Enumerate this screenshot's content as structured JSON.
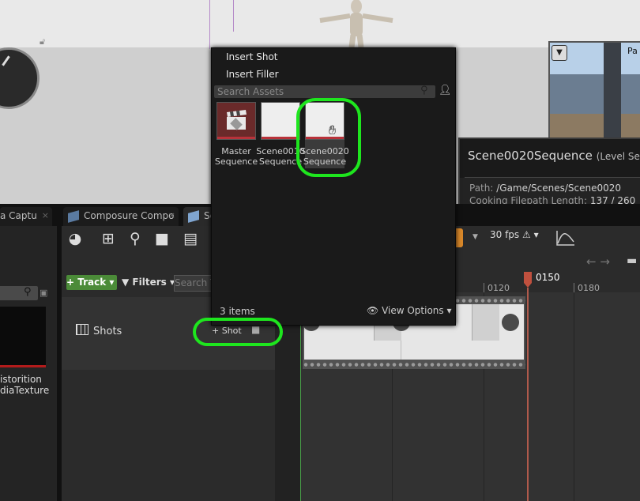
{
  "viewport": {
    "preview_label": "Pa",
    "preview_dropdown": "▼"
  },
  "tooltip": {
    "title": "Scene0020Sequence",
    "title_type": "(Level Seque",
    "path_label": "Path:",
    "path_value": "/Game/Scenes/Scene0020",
    "cooking_label": "Cooking Filepath Length:",
    "cooking_value": "137 / 260"
  },
  "tabs": [
    {
      "label": "a Captu",
      "close": "×"
    },
    {
      "label": "Composure Compo",
      "close": "×"
    },
    {
      "label": "Se",
      "close": ""
    }
  ],
  "left_panel": {
    "line1": "istorition",
    "line2": "diaTexture"
  },
  "sequencer": {
    "track_button": "+ Track ▾",
    "filters_button": "▼ Filters ▾",
    "search_placeholder": "Search T",
    "shots_label": "Shots",
    "shot_button": "+ Shot",
    "fps_label": "30 fps",
    "playhead_frame": "0150",
    "ticks": [
      "0120",
      "0180"
    ]
  },
  "menu": {
    "insert_shot": "Insert Shot",
    "insert_filler": "Insert Filler",
    "search_placeholder": "Search Assets",
    "assets": [
      {
        "name_line1": "Master",
        "name_line2": "Sequence"
      },
      {
        "name_line1": "Scene0010",
        "name_line2": "Sequence"
      },
      {
        "name_line1": "Scene0020",
        "name_line2": "Sequence"
      }
    ],
    "items_count": "3 items",
    "view_options": "View Options"
  },
  "colors": {
    "highlight": "#1ee61e",
    "track_button": "#4b8b38",
    "playhead": "#c0503e",
    "accent_orange": "#d9882a"
  }
}
